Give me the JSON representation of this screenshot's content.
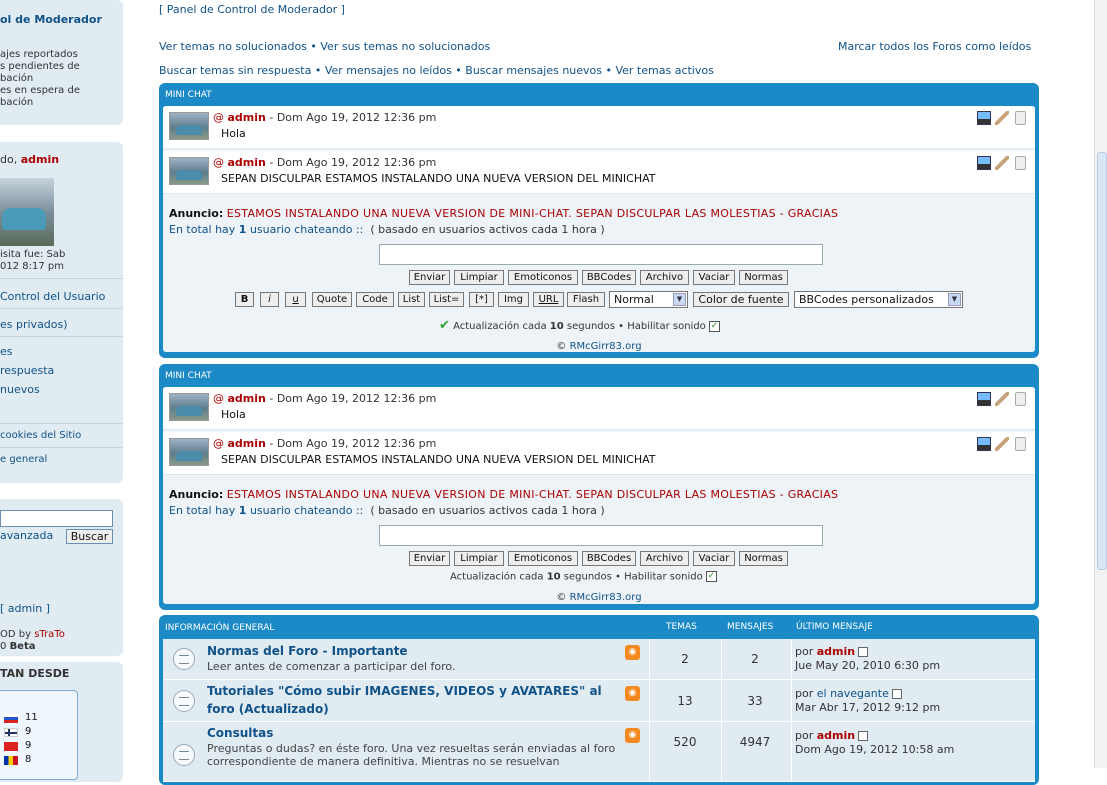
{
  "top": {
    "panel_link": "[ Panel de Control de Moderador ]",
    "left_links": "Ver temas no solucionados • Ver sus temas no solucionados",
    "right_link": "Marcar todos los Foros como leídos",
    "search_links": "Buscar temas sin respuesta • Ver mensajes no leídos • Buscar mensajes nuevos • Ver temas activos"
  },
  "sidebar": {
    "mod_title": "ol de Moderador",
    "mod_items": [
      "ajes reportados",
      "s pendientes de",
      "bación",
      "es en espera de",
      "bación"
    ],
    "welcome_prefix": "do,",
    "welcome_user": "admin",
    "visit_line1": "isita fue: Sab",
    "visit_line2": "012 8:17 pm",
    "ucp": "Control del Usuario",
    "private": "es privados)",
    "links": [
      "es",
      "respuesta",
      "nuevos"
    ],
    "cookies": "cookies del Sitio",
    "general": "e general",
    "adv_search": "avanzada",
    "search_btn": "Buscar",
    "admin_link": "[ admin ]",
    "mod_by_prefix": "OD by",
    "mod_by_user": "sTraTo",
    "version_prefix": "0",
    "version_beta": "Beta",
    "desde": "TAN DESDE",
    "flag_counts": [
      "11",
      "9",
      "9",
      "8"
    ]
  },
  "chat": {
    "header": "MINI CHAT",
    "messages": [
      {
        "user": "admin",
        "date": "- Dom Ago 19, 2012 12:36 pm",
        "text": "Hola"
      },
      {
        "user": "admin",
        "date": "- Dom Ago 19, 2012 12:36 pm",
        "text": "SEPAN DISCULPAR ESTAMOS INSTALANDO UNA NUEVA VERSION DEL MINICHAT"
      }
    ],
    "at": "@",
    "anuncio_label": "Anuncio:",
    "anuncio_text": "ESTAMOS INSTALANDO UNA NUEVA VERSION DE MINI-CHAT. SEPAN DISCULPAR LAS MOLESTIAS - GRACIAS",
    "total_prefix": "En total hay",
    "total_num": "1",
    "total_mid": "usuario chateando ::",
    "total_suffix": "( basado en usuarios activos cada 1 hora )",
    "buttons": [
      "Enviar",
      "Limpiar",
      "Emoticonos",
      "BBCodes",
      "Archivo",
      "Vaciar",
      "Normas"
    ],
    "bb_buttons": [
      "B",
      "i",
      "u",
      "Quote",
      "Code",
      "List",
      "List=",
      "[*]",
      "Img",
      "URL",
      "Flash"
    ],
    "size_select": "Normal",
    "color_btn": "Color de fuente",
    "custom_select": "BBCodes personalizados",
    "update_prefix": "Actualización cada",
    "update_num": "10",
    "update_suffix": "segundos •",
    "sound": "Habilitar sonido",
    "copyright": "©",
    "copyright_link": "RMcGirr83.org"
  },
  "forum": {
    "header": "INFORMACIÓN GENERAL",
    "col_temas": "TEMAS",
    "col_mensajes": "MENSAJES",
    "col_ultimo": "ÚLTIMO MENSAJE",
    "por": "por",
    "rows": [
      {
        "title": "Normas del Foro - Importante",
        "desc": "Leer antes de comenzar a participar del foro.",
        "temas": "2",
        "mensajes": "2",
        "user": "admin",
        "user_red": true,
        "date": "Jue May 20, 2010 6:30 pm"
      },
      {
        "title": "Tutoriales \"Cómo subir IMAGENES, VIDEOS y AVATARES\" al foro (Actualizado)",
        "desc": "",
        "temas": "13",
        "mensajes": "33",
        "user": "el navegante",
        "user_red": false,
        "date": "Mar Abr 17, 2012 9:12 pm"
      },
      {
        "title": "Consultas",
        "desc": "Preguntas o dudas? en éste foro. Una vez resueltas serán enviadas al foro correspondiente de manera definitiva. Mientras no se resuelvan",
        "temas": "520",
        "mensajes": "4947",
        "user": "admin",
        "user_red": true,
        "date": "Dom Ago 19, 2012 10:58 am"
      }
    ]
  },
  "colors": {
    "accent": "#1c8ac7",
    "dark_red": "#aa0000",
    "link": "#105289",
    "row_bg": "#e1ebf2"
  }
}
